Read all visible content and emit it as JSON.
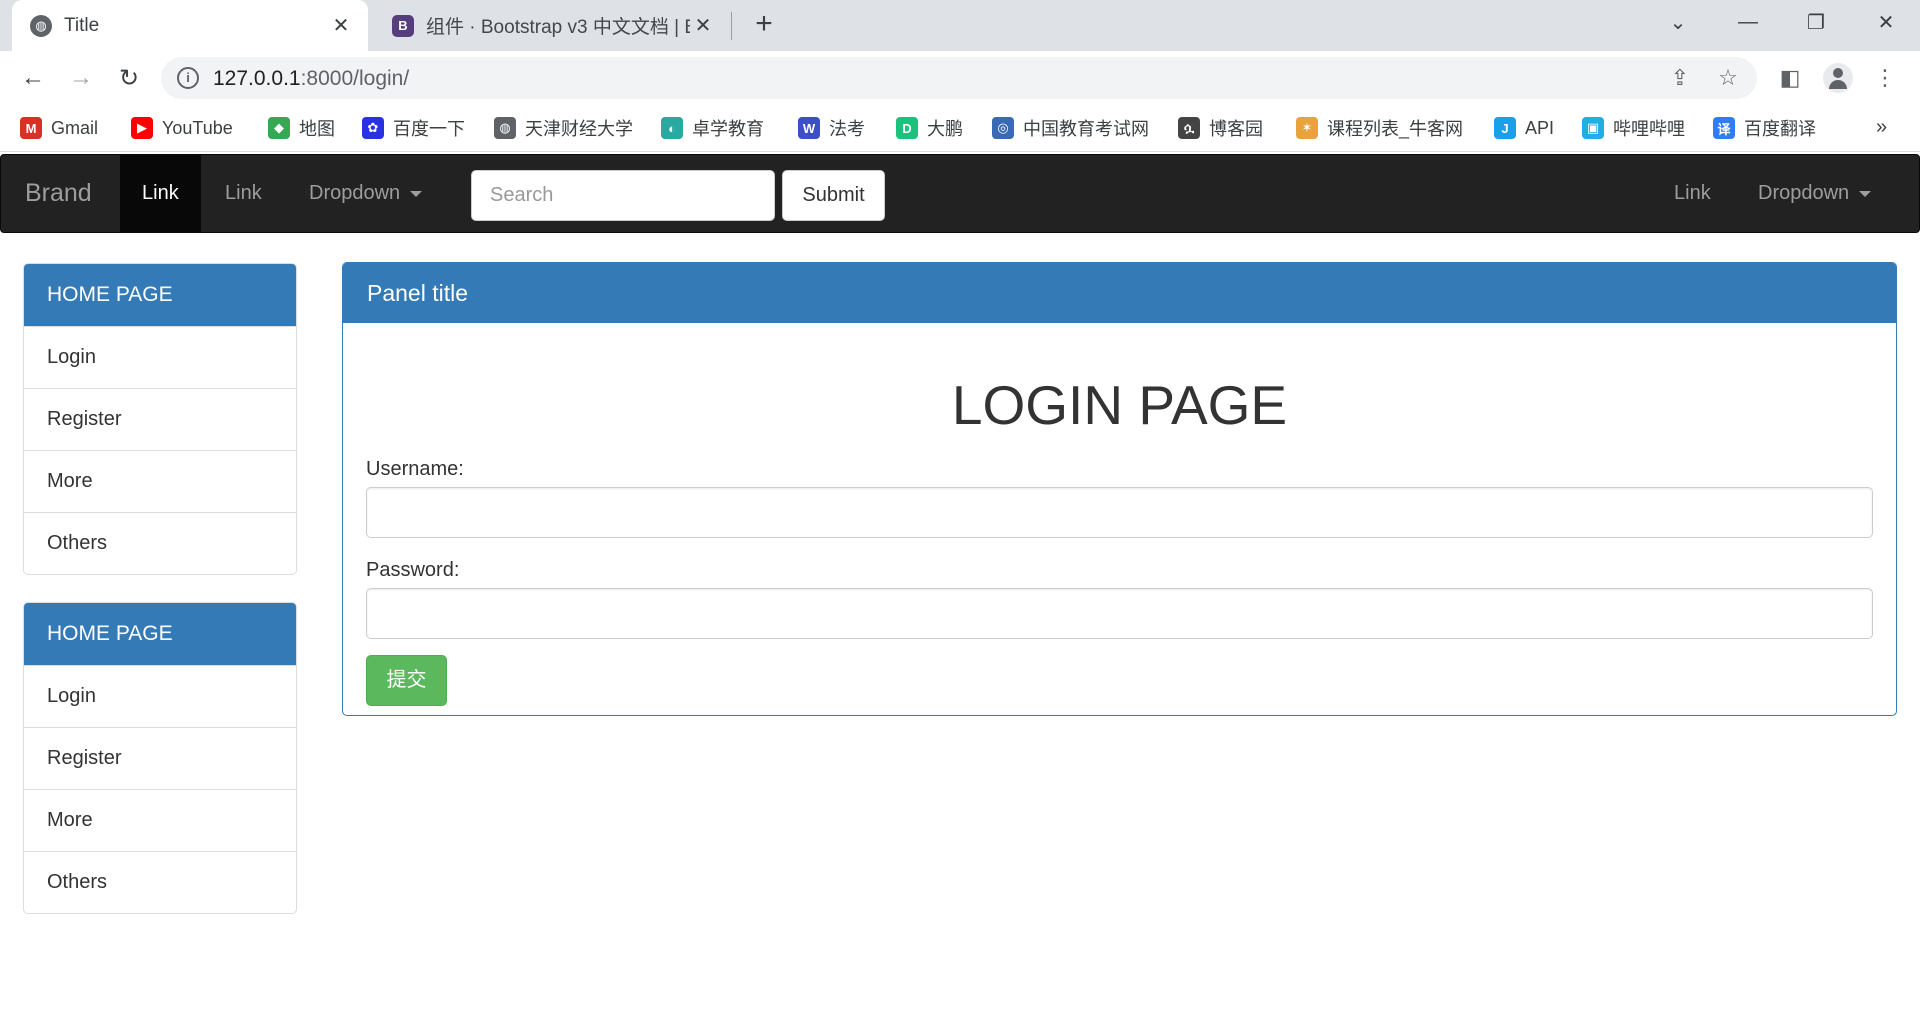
{
  "browser": {
    "tabs": [
      {
        "title": "Title",
        "active": true
      },
      {
        "title": "组件 · Bootstrap v3 中文文档 | B",
        "active": false
      }
    ],
    "address": {
      "host": "127.0.0.1",
      "rest": ":8000/login/"
    },
    "bookmarks": [
      {
        "label": "Gmail",
        "icon": "gmail-icon",
        "color": "#d93025",
        "glyph": "M"
      },
      {
        "label": "YouTube",
        "icon": "youtube-icon",
        "color": "#ff0000",
        "glyph": "▶"
      },
      {
        "label": "地图",
        "icon": "maps-icon",
        "color": "#34a853",
        "glyph": "◆"
      },
      {
        "label": "百度一下",
        "icon": "baidu-paw-icon",
        "color": "#2932e1",
        "glyph": "✿"
      },
      {
        "label": "天津财经大学",
        "icon": "globe-icon",
        "color": "#5f6368",
        "glyph": "◍"
      },
      {
        "label": "卓学教育",
        "icon": "zhuoxue-icon",
        "color": "#2aa9a0",
        "glyph": "◐"
      },
      {
        "label": "法考",
        "icon": "fakao-icon",
        "color": "#3b4fc9",
        "glyph": "W"
      },
      {
        "label": "大鹏",
        "icon": "dapeng-icon",
        "color": "#19c37d",
        "glyph": "D"
      },
      {
        "label": "中国教育考试网",
        "icon": "neea-icon",
        "color": "#3a6ab3",
        "glyph": "◎"
      },
      {
        "label": "博客园",
        "icon": "cnblogs-icon",
        "color": "#444444",
        "glyph": "ሷ"
      },
      {
        "label": "课程列表_牛客网",
        "icon": "nowcoder-icon",
        "color": "#e8a33c",
        "glyph": "✶"
      },
      {
        "label": "API",
        "icon": "api-icon",
        "color": "#1aa0e8",
        "glyph": "J"
      },
      {
        "label": "哔哩哔哩",
        "icon": "bilibili-icon",
        "color": "#23ade5",
        "glyph": "▣"
      },
      {
        "label": "百度翻译",
        "icon": "baidu-translate-icon",
        "color": "#2f7cf6",
        "glyph": "译"
      }
    ],
    "bookmarks_more": "»"
  },
  "navbar": {
    "brand": "Brand",
    "left_links": [
      "Link",
      "Link",
      "Dropdown"
    ],
    "search_placeholder": "Search",
    "submit_label": "Submit",
    "right_links": [
      "Link",
      "Dropdown"
    ]
  },
  "sidebar": {
    "panels": [
      {
        "heading": "HOME PAGE",
        "items": [
          "Login",
          "Register",
          "More",
          "Others"
        ]
      },
      {
        "heading": "HOME PAGE",
        "items": [
          "Login",
          "Register",
          "More",
          "Others"
        ]
      }
    ]
  },
  "main": {
    "panel_title": "Panel title",
    "page_heading": "LOGIN PAGE",
    "username_label": "Username:",
    "password_label": "Password:",
    "submit_label": "提交"
  },
  "colors": {
    "primary": "#337ab7",
    "success": "#5cb85c",
    "navbar": "#222222"
  }
}
